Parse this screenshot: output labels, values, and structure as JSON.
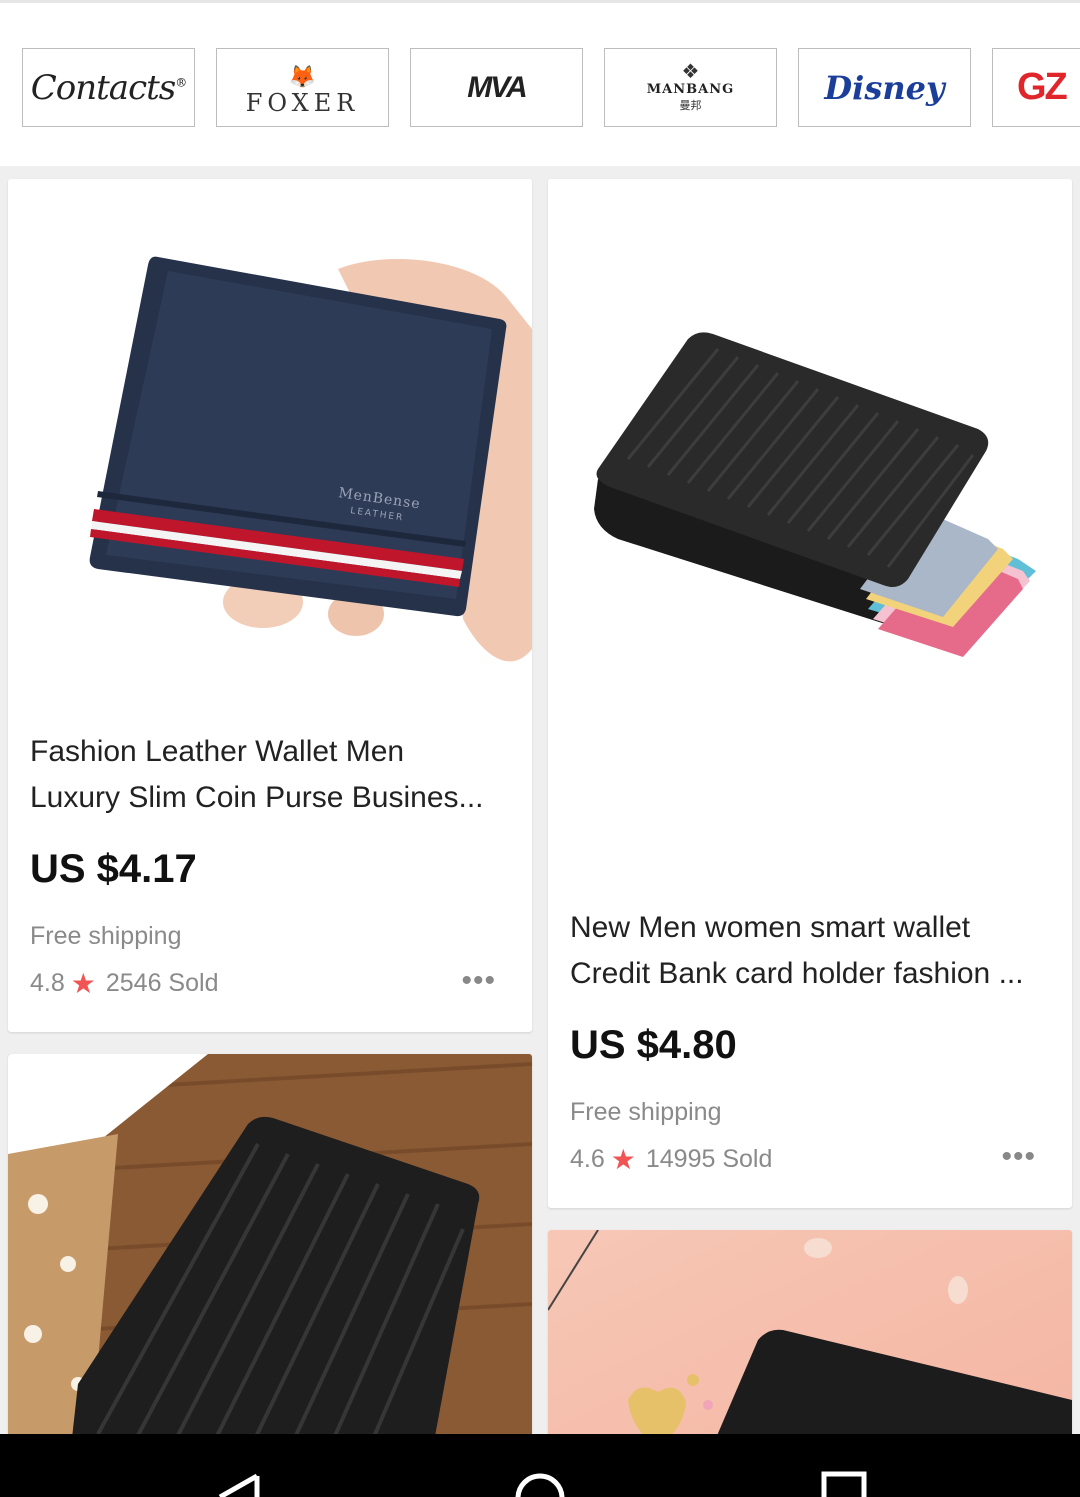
{
  "brands": [
    {
      "name": "Contacts",
      "mark": "®"
    },
    {
      "name": "FOXER"
    },
    {
      "name": "MVA"
    },
    {
      "name": "MANBANG",
      "sub": "曼邦"
    },
    {
      "name": "Disney"
    },
    {
      "name": "GZ"
    }
  ],
  "products": [
    {
      "title_line1": "Fashion Leather Wallet Men",
      "title_line2": "Luxury Slim Coin Purse Busines...",
      "price": "US $4.17",
      "shipping": "Free shipping",
      "rating": "4.8",
      "sold": "2546 Sold",
      "imprint": "MenBense",
      "imprint_sub": "LEATHER"
    },
    {
      "title_line1": "New Men women smart wallet",
      "title_line2": "Credit Bank card holder fashion ...",
      "price": "US $4.80",
      "shipping": "Free shipping",
      "rating": "4.6",
      "sold": "14995 Sold"
    }
  ],
  "colors": {
    "star": "#f25353",
    "disney": "#1a3e9a",
    "gz": "#e0252b"
  },
  "icons": {
    "rating": "star-icon",
    "more": "more-dots-icon",
    "nav_back": "back-triangle-icon",
    "nav_home": "home-circle-icon",
    "nav_recents": "recents-square-icon"
  }
}
